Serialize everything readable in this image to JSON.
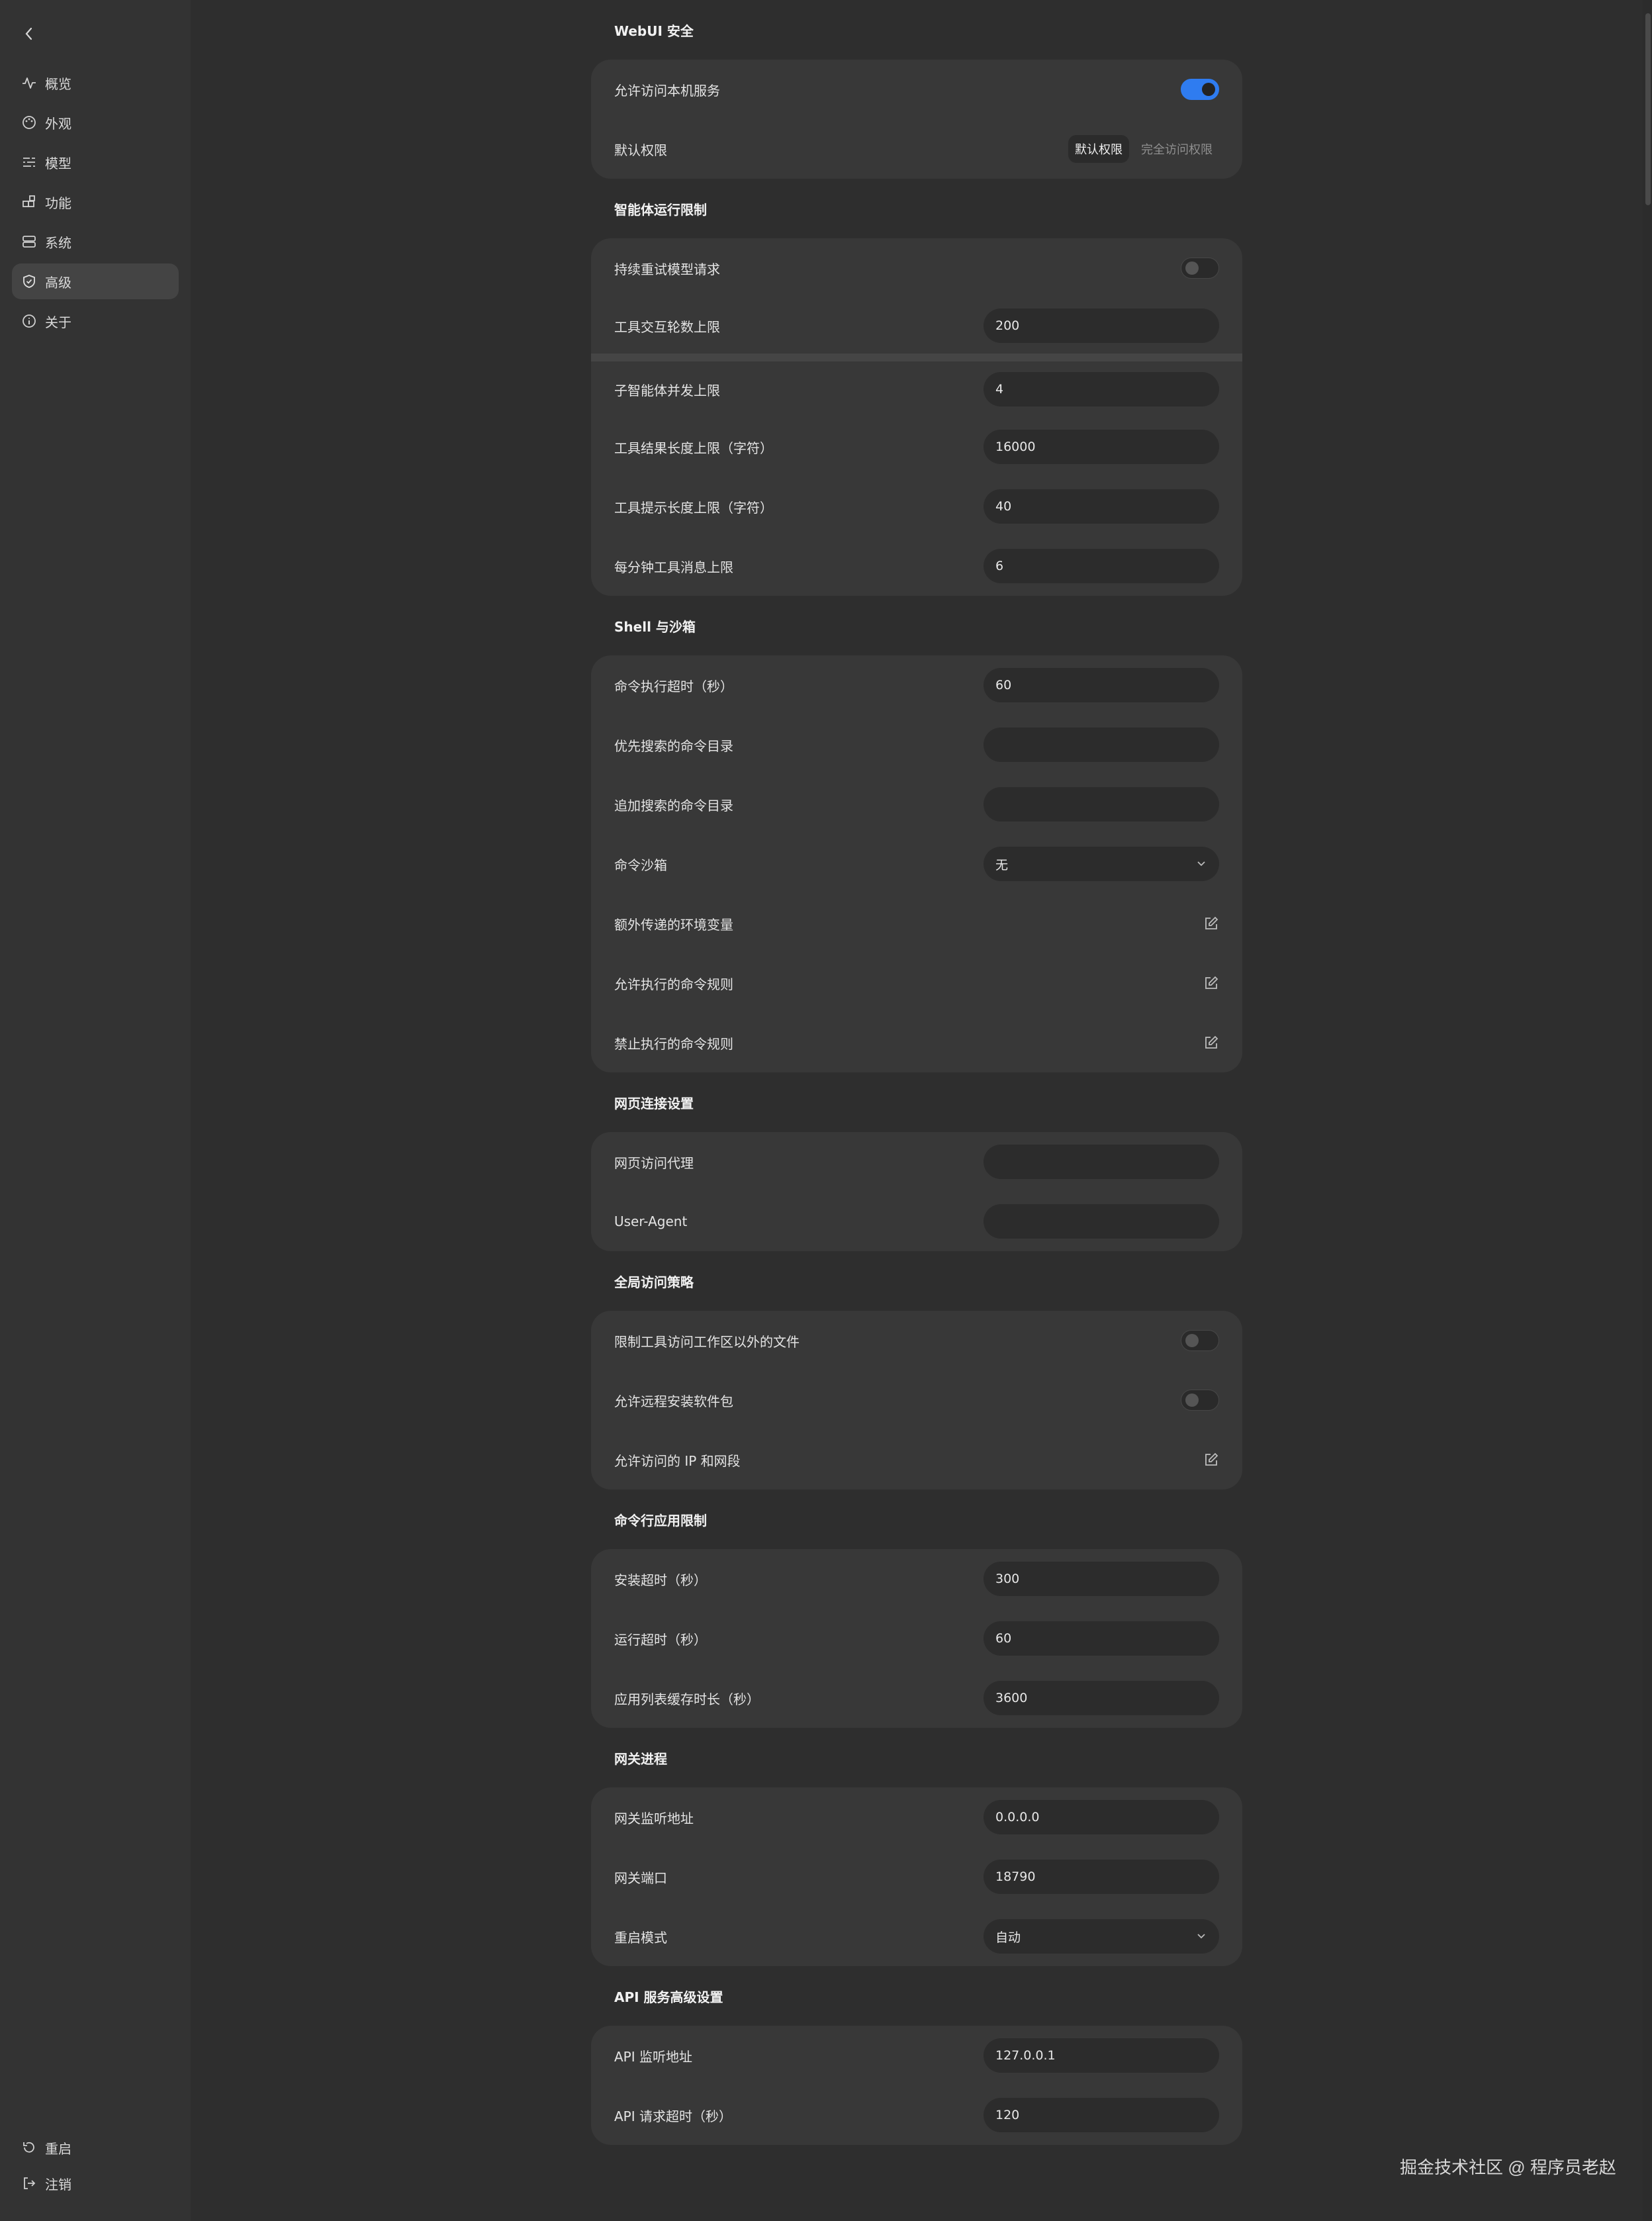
{
  "sidebar": {
    "back_icon": "chevron-left-icon",
    "items": [
      {
        "label": "概览",
        "icon": "activity-icon"
      },
      {
        "label": "外观",
        "icon": "palette-icon"
      },
      {
        "label": "模型",
        "icon": "sliders-icon"
      },
      {
        "label": "功能",
        "icon": "blocks-icon"
      },
      {
        "label": "系统",
        "icon": "server-icon"
      },
      {
        "label": "高级",
        "icon": "shield-icon",
        "active": true
      },
      {
        "label": "关于",
        "icon": "info-icon"
      }
    ],
    "bottom": [
      {
        "label": "重启",
        "icon": "restart-icon"
      },
      {
        "label": "注销",
        "icon": "logout-icon"
      }
    ]
  },
  "webui": {
    "title": "WebUI 安全",
    "allow_local": {
      "label": "允许访问本机服务",
      "on": true
    },
    "default_perm": {
      "label": "默认权限",
      "options": [
        "默认权限",
        "完全访问权限"
      ],
      "selected": "默认权限"
    }
  },
  "agent": {
    "title": "智能体运行限制",
    "retry": {
      "label": "持续重试模型请求",
      "on": false
    },
    "tool_rounds": {
      "label": "工具交互轮数上限",
      "value": "200"
    },
    "sub_agents": {
      "label": "子智能体并发上限",
      "value": "4"
    },
    "tool_result_len": {
      "label": "工具结果长度上限（字符）",
      "value": "16000"
    },
    "tool_hint_len": {
      "label": "工具提示长度上限（字符）",
      "value": "40"
    },
    "tool_msgs_per_min": {
      "label": "每分钟工具消息上限",
      "value": "6"
    }
  },
  "shell": {
    "title": "Shell 与沙箱",
    "timeout": {
      "label": "命令执行超时（秒）",
      "value": "60"
    },
    "prefer_dirs": {
      "label": "优先搜索的命令目录",
      "value": ""
    },
    "extra_dirs": {
      "label": "追加搜索的命令目录",
      "value": ""
    },
    "sandbox": {
      "label": "命令沙箱",
      "value": "无"
    },
    "env": {
      "label": "额外传递的环境变量"
    },
    "allow_rules": {
      "label": "允许执行的命令规则"
    },
    "deny_rules": {
      "label": "禁止执行的命令规则"
    }
  },
  "web": {
    "title": "网页连接设置",
    "proxy": {
      "label": "网页访问代理",
      "value": ""
    },
    "ua": {
      "label": "User-Agent",
      "value": ""
    }
  },
  "global": {
    "title": "全局访问策略",
    "restrict_files": {
      "label": "限制工具访问工作区以外的文件",
      "on": false
    },
    "remote_install": {
      "label": "允许远程安装软件包",
      "on": false
    },
    "allowed_ips": {
      "label": "允许访问的 IP 和网段"
    }
  },
  "cli": {
    "title": "命令行应用限制",
    "install_timeout": {
      "label": "安装超时（秒）",
      "value": "300"
    },
    "run_timeout": {
      "label": "运行超时（秒）",
      "value": "60"
    },
    "cache_ttl": {
      "label": "应用列表缓存时长（秒）",
      "value": "3600"
    }
  },
  "gateway": {
    "title": "网关进程",
    "listen": {
      "label": "网关监听地址",
      "value": "0.0.0.0"
    },
    "port": {
      "label": "网关端口",
      "value": "18790"
    },
    "restart_mode": {
      "label": "重启模式",
      "value": "自动"
    }
  },
  "api": {
    "title": "API 服务高级设置",
    "listen": {
      "label": "API 监听地址",
      "value": "127.0.0.1"
    },
    "timeout": {
      "label": "API 请求超时（秒）",
      "value": "120"
    }
  },
  "watermark": "掘金技术社区 @ 程序员老赵",
  "colors": {
    "accent": "#2f7cf0",
    "bg": "#2e2e2e",
    "card": "#383838",
    "sidebar": "#333333"
  }
}
